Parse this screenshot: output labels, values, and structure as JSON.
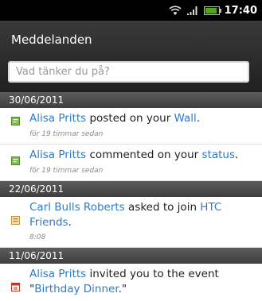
{
  "status_bar": {
    "time": "17:40",
    "icons": [
      "wifi-icon",
      "signal-icon",
      "battery-icon"
    ],
    "battery_color": "#4fa51f"
  },
  "header": {
    "title": "Meddelanden",
    "search_placeholder": "Vad tänker du på?"
  },
  "sections": [
    {
      "date": "30/06/2011",
      "items": [
        {
          "icon": "wall-post-icon",
          "actor": "Alisa Pritts",
          "text": " posted on your ",
          "target": "Wall",
          "suffix": ".",
          "time": "för 19 timmar sedan"
        },
        {
          "icon": "comment-icon",
          "actor": "Alisa Pritts",
          "text": " commented on your ",
          "target": "status",
          "suffix": ".",
          "time": "för 19 timmar sedan"
        }
      ]
    },
    {
      "date": "22/06/2011",
      "items": [
        {
          "icon": "group-invite-icon",
          "actor": "Carl Bulls Roberts",
          "text": " asked to join ",
          "target": "HTC Friends",
          "suffix": ".",
          "time": "8:08"
        }
      ]
    },
    {
      "date": "11/06/2011",
      "items": [
        {
          "icon": "event-calendar-icon",
          "actor": "Alisa Pritts",
          "text": " invited you to the event \"",
          "target": "Birthday Dinner",
          "suffix": ".\""
        }
      ]
    }
  ],
  "colors": {
    "link": "#2f7ac8",
    "section_header": "#4a4a4a",
    "header_bg": "#2b2b2b"
  }
}
